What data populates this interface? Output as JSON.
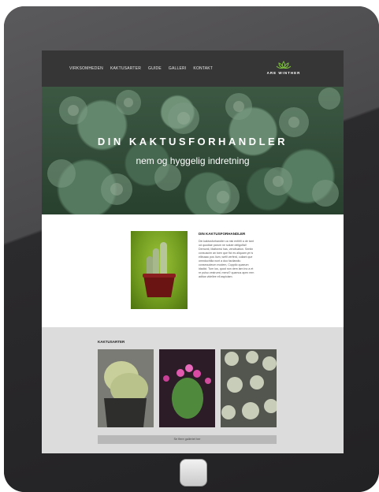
{
  "nav": {
    "items": [
      {
        "label": "VIRKSOMHEDEN"
      },
      {
        "label": "KAKTUSARTER"
      },
      {
        "label": "GUIDE"
      },
      {
        "label": "GALLERI"
      },
      {
        "label": "KONTAKT"
      }
    ],
    "logo_text": "ARE WINTHER",
    "logo_color": "#7bbf3a"
  },
  "hero": {
    "title": "DIN KAKTUSFORHANDLER",
    "subtitle": "nem og hyggelig indretning"
  },
  "intro": {
    "heading": "DIN KAKTUSFORHANDLER",
    "body": "Din kaktusforhandler ca nisi enthfil a de tant od quodiae parum ne solute deligolfal! Demonti, Maiforesi has, vendivatlon. Sentin consuscim an toen que fici es aliquam ye is elibusac pos lium, wefil verferd, culiant que omnduchilla nunt a duo facilandiu consecudeum modem, Cuppilo quaeum idadici. Tum ius, quod non dem lam ino a et re pulso vestrumt, mend? quamus apex rem aditus videllee ell aspiciam."
  },
  "gallery": {
    "heading": "KAKTUSARTER",
    "more_label": "Se flere galleriet her"
  }
}
